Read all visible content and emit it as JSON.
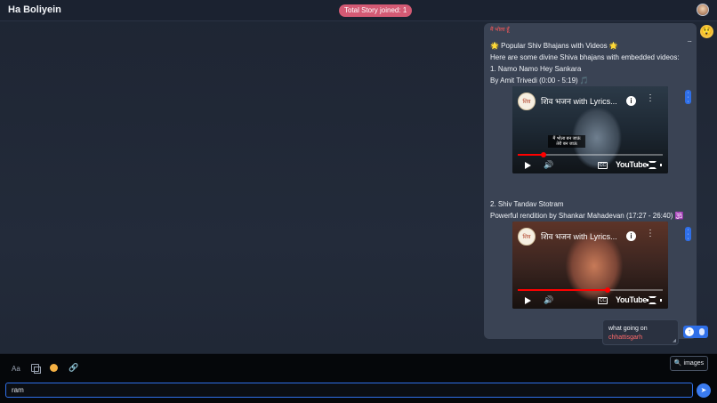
{
  "header": {
    "title": "Ha Boliyein",
    "story_pill": "Total Story joined: 1",
    "avatar_icon": "user-avatar"
  },
  "chat": {
    "emoji_badge": "😲",
    "message": {
      "sender": "मैं भोला हूँ",
      "menu": "...",
      "lines": [
        "🌟 Popular Shiv Bhajans with Videos 🌟",
        "Here are some divine Shiva bhajans with embedded videos:",
        "1. Namo Namo Hey Sankara",
        "By Amit Trivedi (0:00 - 5:19) 🎵",
        "2. Shiv Tandav Stotram",
        "Powerful rendition by Shankar Mahadevan (17:27 - 26:40) 🕉️"
      ],
      "videos": [
        {
          "title": "शिव भजन with Lyrics...",
          "logo_text": "शिव",
          "overlay_text": "मैं भोला बन जाऊं तेरी बन जाऊं",
          "progress": 0.18,
          "youtube_label": "YouTube",
          "cc_label": "CC"
        },
        {
          "title": "शिव भजन with Lyrics...",
          "logo_text": "शिव",
          "overlay_text": "",
          "progress": 0.62,
          "youtube_label": "YouTube",
          "cc_label": "CC"
        }
      ]
    },
    "reply_bubble": {
      "line1": "what going on",
      "line2": "chhattisgarh"
    },
    "upload_icon": "upload-arrow-icon"
  },
  "composer": {
    "format_label": "Aa",
    "images_button": "images",
    "input_value": "ram",
    "input_placeholder": "",
    "send_icon": "send-icon"
  },
  "colors": {
    "accent": "#2f6fe8",
    "pill": "#d45a74",
    "sender": "#ff5a5a",
    "progress": "#ff0000"
  }
}
